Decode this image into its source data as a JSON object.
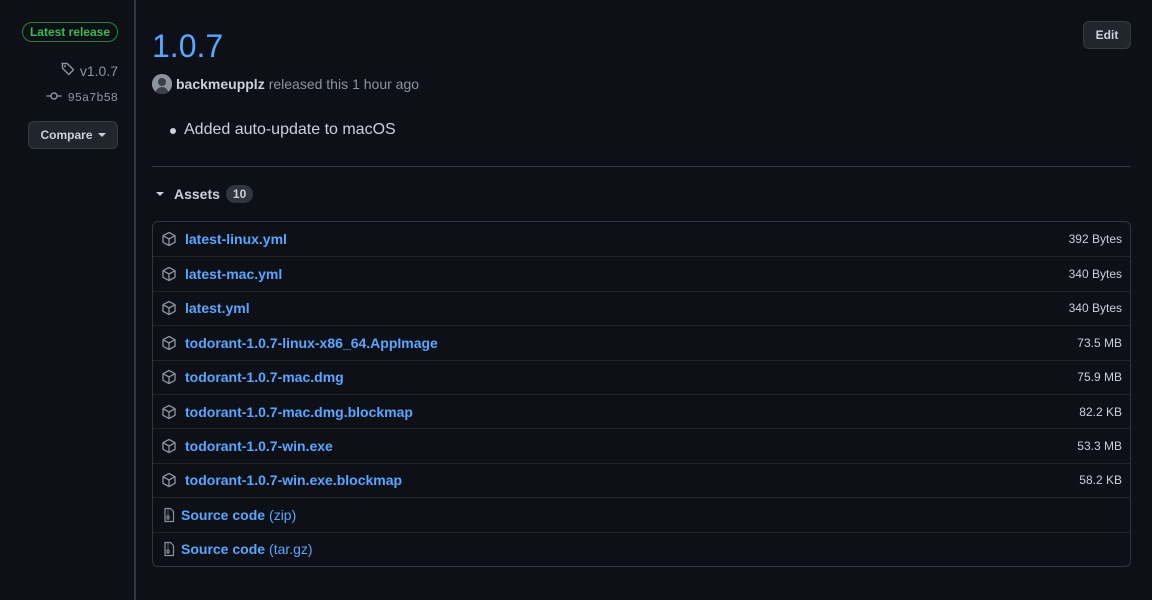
{
  "sidebar": {
    "latest_badge": "Latest release",
    "tag": "v1.0.7",
    "commit": "95a7b58",
    "compare_label": "Compare"
  },
  "release": {
    "title": "1.0.7",
    "edit_label": "Edit",
    "author": "backmeupplz",
    "released_text": "released this",
    "time_ago": "1 hour ago",
    "notes": [
      "Added auto-update to macOS"
    ]
  },
  "assets": {
    "label": "Assets",
    "count": "10",
    "files": [
      {
        "name": "latest-linux.yml",
        "size": "392 Bytes"
      },
      {
        "name": "latest-mac.yml",
        "size": "340 Bytes"
      },
      {
        "name": "latest.yml",
        "size": "340 Bytes"
      },
      {
        "name": "todorant-1.0.7-linux-x86_64.AppImage",
        "size": "73.5 MB"
      },
      {
        "name": "todorant-1.0.7-mac.dmg",
        "size": "75.9 MB"
      },
      {
        "name": "todorant-1.0.7-mac.dmg.blockmap",
        "size": "82.2 KB"
      },
      {
        "name": "todorant-1.0.7-win.exe",
        "size": "53.3 MB"
      },
      {
        "name": "todorant-1.0.7-win.exe.blockmap",
        "size": "58.2 KB"
      }
    ],
    "sources": [
      {
        "name": "Source code",
        "suffix": "(zip)"
      },
      {
        "name": "Source code",
        "suffix": "(tar.gz)"
      }
    ]
  },
  "icons": {
    "package": "package-icon",
    "file_zip": "file-zip-icon",
    "tag": "tag-icon",
    "commit": "git-commit-icon"
  },
  "colors": {
    "background": "#0d1117",
    "link": "#58a6ff",
    "success": "#3fb950",
    "border": "#30363d"
  }
}
